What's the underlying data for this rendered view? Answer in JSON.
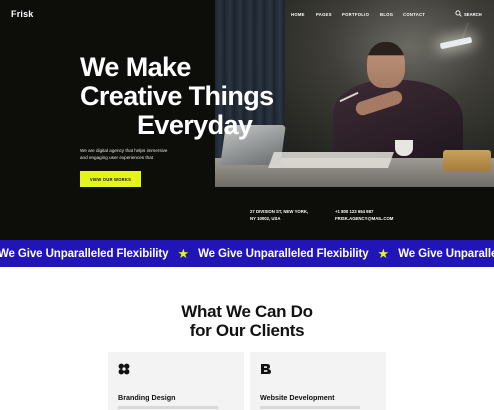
{
  "brand": {
    "logo": "Frisk",
    "accent": "#e3f51b",
    "marquee_bg": "#2115b7"
  },
  "nav": {
    "items": [
      "HOME",
      "PAGES",
      "PORTFOLIO",
      "BLOG",
      "CONTACT"
    ],
    "search_label": "SEARCH",
    "search_icon": "search-icon"
  },
  "hero": {
    "headline_1": "We Make",
    "headline_2": "Creative Things",
    "headline_3": "Everyday",
    "subtext_1": "We are digital agency that helps immersive",
    "subtext_2": "and engaging user experiences that",
    "cta": "VIEW OUR WORKS",
    "address_1": "27 DIVISION ST, NEW YORK,",
    "address_2": "NY 10002, USA",
    "phone": "+1 800 123 654 987",
    "email": "FRISK.AGENCY@MAIL.COM"
  },
  "marquee": {
    "items": [
      "We Give Unparalleled Flexibility",
      "We Give Unparalleled Flexibility",
      "We Give Unparalleled F"
    ],
    "separator": "★"
  },
  "services": {
    "title_1": "What We Can Do",
    "title_2": "for Our Clients",
    "cards": [
      {
        "title": "Branding Design",
        "icon": "clover-icon"
      },
      {
        "title": "Website Development",
        "icon": "b-shape-icon"
      }
    ]
  }
}
